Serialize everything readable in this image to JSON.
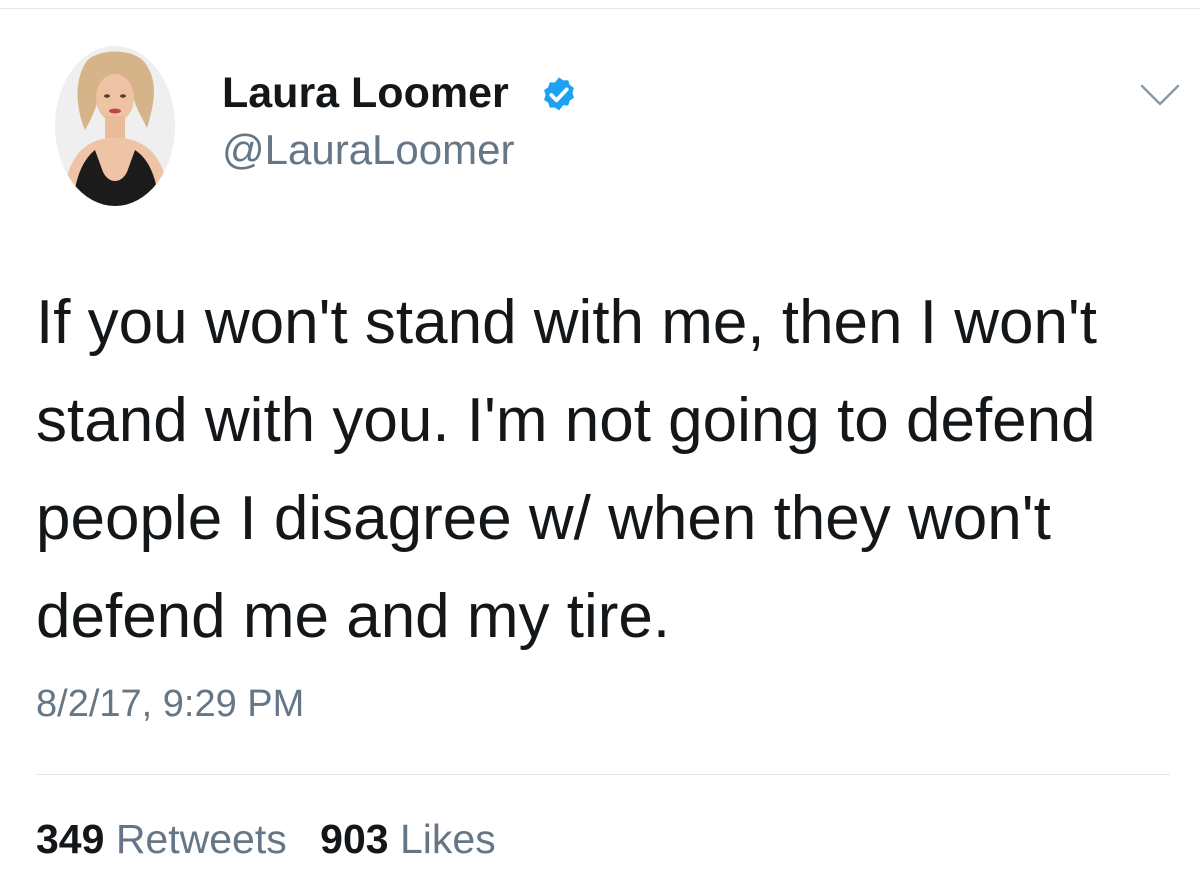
{
  "tweet": {
    "author": {
      "display_name": "Laura Loomer",
      "handle": "@LauraLoomer",
      "verified": true
    },
    "text": "If you won't stand with me, then I won't stand with you. I'm not going to defend people I disagree w/ when they won't defend me and my tire.",
    "timestamp": "8/2/17, 9:29 PM",
    "stats": {
      "retweets_count": "349",
      "retweets_label": "Retweets",
      "likes_count": "903",
      "likes_label": "Likes"
    }
  },
  "icons": {
    "verified": "verified-badge-icon",
    "menu": "chevron-down-icon"
  },
  "colors": {
    "primary_text": "#14171a",
    "secondary_text": "#657786",
    "verified_blue": "#1da1f2",
    "divider": "#e1e8ed"
  }
}
